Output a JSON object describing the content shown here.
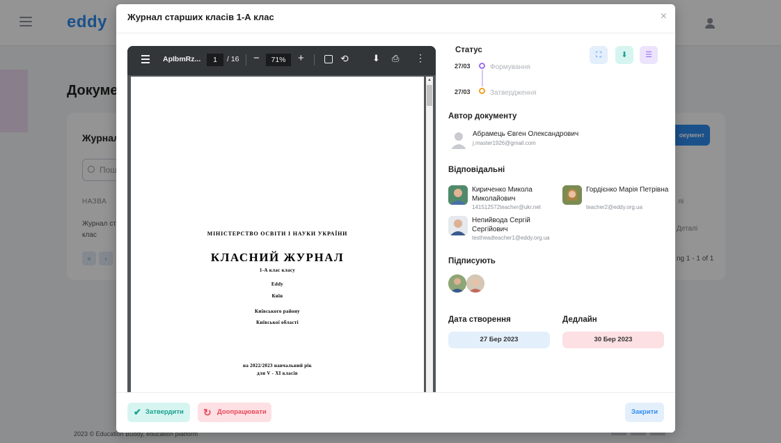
{
  "background": {
    "logo": "eddy",
    "page_title": "Докумен",
    "card_title": "Журнали",
    "search_placeholder": "Пош",
    "column_name": "НАЗВА",
    "row_name": "Журнал ст... клас",
    "pagination": [
      "«",
      "‹"
    ],
    "add_button": "окумент",
    "column_details": "лі",
    "row_details": "Деталі",
    "rows_info": "ng 1 - 1 of 1",
    "footer": "2023 © Education Buddy, education platform"
  },
  "modal": {
    "title": "Журнал старших класів 1-А клас",
    "close_icon": "×"
  },
  "pdf": {
    "file_name": "ApIbmRz...",
    "page_current": "1",
    "page_total": "/ 16",
    "zoom": "71%",
    "ministry": "МІНІСТЕРСТВО ОСВІТИ І НАУКИ УКРАЇНИ",
    "doc_title": "КЛАСНИЙ ЖУРНАЛ",
    "class_line": "1-А клас класу",
    "school": "Eddy",
    "city": "Київ",
    "district": "Київського району",
    "region": "Київської області",
    "year": "на 2022/2023 навчальний рік",
    "grades": "для V - XI класів"
  },
  "status": {
    "title": "Статус",
    "steps": [
      {
        "date": "27/03",
        "label": "Формування"
      },
      {
        "date": "27/03",
        "label": "Затвердження"
      }
    ]
  },
  "author": {
    "title": "Автор документу",
    "name": "Абрамець Євген Олександрович",
    "email": "j.master1926@gmail.com"
  },
  "responsible": {
    "title": "Відповідальні",
    "people": [
      {
        "name": "Кириченко Микола Миколайович",
        "email": "141512572teacher@ukr.net"
      },
      {
        "name": "Гордієнко Марія Петрівна",
        "email": "teacher2@eddy.org.ua"
      },
      {
        "name": "Непийвода Сергій Сергійович",
        "email": "testheadteacher1@eddy.org.ua"
      }
    ]
  },
  "signers": {
    "title": "Підписують"
  },
  "dates": {
    "created_label": "Дата створення",
    "created_value": "27 Бер 2023",
    "deadline_label": "Дедлайн",
    "deadline_value": "30 Бер 2023"
  },
  "footer": {
    "approve": "Затвердити",
    "revise": "Доопрацювати",
    "close": "Закрити"
  },
  "colors": {
    "primary": "#2e8cf0",
    "status_purple": "#9b6ef0",
    "status_orange": "#f0a020",
    "approve_bg": "#d6f5f1",
    "revise_bg": "#fde0e3",
    "deadline_bg": "#fde0e3",
    "created_bg": "#e4effc"
  }
}
